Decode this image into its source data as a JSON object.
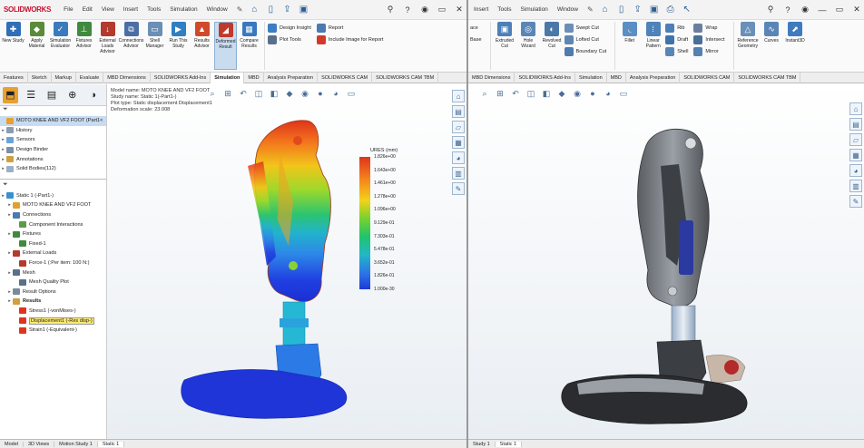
{
  "left": {
    "logo": "SOLIDWORKS",
    "menu": [
      "File",
      "Edit",
      "View",
      "Insert",
      "Tools",
      "Simulation",
      "Window"
    ],
    "ribbon": [
      {
        "label": "New Study",
        "icon": "new-study-icon",
        "color": "#2e6fb5",
        "glyph": "✚"
      },
      {
        "label": "Apply Material",
        "icon": "material-icon",
        "color": "#5b8a3a",
        "glyph": "◆"
      },
      {
        "label": "Simulation Evaluator",
        "icon": "evaluator-icon",
        "color": "#3b7bbd",
        "glyph": "✓"
      },
      {
        "label": "Fixtures Advisor",
        "icon": "fixture-icon",
        "color": "#3f8a3f",
        "glyph": "⊥"
      },
      {
        "label": "External Loads Advisor",
        "icon": "load-icon",
        "color": "#b33a2e",
        "glyph": "↓"
      },
      {
        "label": "Connections Advisor",
        "icon": "connection-icon",
        "color": "#4b6fa5",
        "glyph": "⧉"
      },
      {
        "label": "Shell Manager",
        "icon": "shell-icon",
        "color": "#6b8fb5",
        "glyph": "▭"
      },
      {
        "label": "Run This Study",
        "icon": "run-icon",
        "color": "#2f7fc1",
        "glyph": "▶"
      },
      {
        "label": "Results Advisor",
        "icon": "results-icon",
        "color": "#d04a2a",
        "glyph": "▲"
      },
      {
        "label": "Deformed Result",
        "icon": "deformed-icon",
        "color": "#c0392b",
        "glyph": "◢"
      },
      {
        "label": "Compare Results",
        "icon": "compare-icon",
        "color": "#3878c0",
        "glyph": "▦"
      }
    ],
    "ribbon_small": [
      "Design Insight",
      "Plot Tools"
    ],
    "ribbon_small2": [
      "Report",
      "Include Image for Report"
    ],
    "tabs": [
      "Features",
      "Sketch",
      "Markup",
      "Evaluate",
      "MBD Dimensions",
      "SOLIDWORKS Add-Ins",
      "Simulation",
      "MBD",
      "Analysis Preparation",
      "SOLIDWORKS CAM",
      "SOLIDWORKS CAM TBM"
    ],
    "active_tab": "Simulation",
    "tree_top": [
      {
        "label": "MOTO KNEE AND VF2 FOOT  (Part1<",
        "sel": true
      },
      {
        "label": "History"
      },
      {
        "label": "Sensors"
      },
      {
        "label": "Design Binder"
      },
      {
        "label": "Annotations"
      },
      {
        "label": "Solid Bodies(112)"
      }
    ],
    "tree_sim": [
      {
        "label": "Static 1 (-Part1-)",
        "indent": 0
      },
      {
        "label": "MOTO KNEE AND VF2 FOOT",
        "indent": 1
      },
      {
        "label": "Connections",
        "indent": 1
      },
      {
        "label": "Component Interactions",
        "indent": 2
      },
      {
        "label": "Fixtures",
        "indent": 1
      },
      {
        "label": "Fixed-1",
        "indent": 2
      },
      {
        "label": "External Loads",
        "indent": 1
      },
      {
        "label": "Force-1 (:Per item: 100 N:)",
        "indent": 2
      },
      {
        "label": "Mesh",
        "indent": 1
      },
      {
        "label": "Mesh Quality Plot",
        "indent": 2
      },
      {
        "label": "Result Options",
        "indent": 1
      },
      {
        "label": "Results",
        "indent": 1,
        "bold": true
      },
      {
        "label": "Stress1 (-vonMises-)",
        "indent": 2
      },
      {
        "label": "Displacement1 (-Res disp-)",
        "indent": 2,
        "highlight": true
      },
      {
        "label": "Strain1 (-Equivalent-)",
        "indent": 2
      }
    ],
    "plot_info": [
      "Model name: MOTO KNEE AND VF2 FOOT",
      "Study name: Static 1(-Part1-)",
      "Plot type: Static displacement Displacement1",
      "Deformation scale: 23.008"
    ],
    "legend_title": "URES (mm)",
    "legend_ticks": [
      "1.826e+00",
      "1.643e+00",
      "1.461e+00",
      "1.278e+00",
      "1.096e+00",
      "9.129e-01",
      "7.303e-01",
      "5.478e-01",
      "3.652e-01",
      "1.826e-01",
      "1.000e-30"
    ],
    "bottom_tabs": [
      "Model",
      "3D Views",
      "Motion Study 1",
      "Static 1"
    ],
    "active_bottom": "Static 1"
  },
  "right": {
    "menu": [
      "Insert",
      "Tools",
      "Simulation",
      "Window"
    ],
    "ribbon": [
      {
        "label": "Extruded Cut",
        "icon": "extruded-cut-icon",
        "color": "#4d7fb8",
        "glyph": "▣"
      },
      {
        "label": "Hole Wizard",
        "icon": "hole-wizard-icon",
        "color": "#5a86b6",
        "glyph": "◎"
      },
      {
        "label": "Revolved Cut",
        "icon": "revolved-cut-icon",
        "color": "#4a79a8",
        "glyph": "◐"
      },
      {
        "label": "Fillet",
        "icon": "fillet-icon",
        "color": "#5b8fc4",
        "glyph": "◟"
      },
      {
        "label": "Linear Pattern",
        "icon": "linear-pattern-icon",
        "color": "#4f82b8",
        "glyph": "⁞"
      },
      {
        "label": "Reference Geometry",
        "icon": "ref-geometry-icon",
        "color": "#6a8fb8",
        "glyph": "△"
      },
      {
        "label": "Curves",
        "icon": "curves-icon",
        "color": "#5a86b6",
        "glyph": "∿"
      },
      {
        "label": "Instant3D",
        "icon": "instant3d-icon",
        "color": "#3f7bbf",
        "glyph": "⬈"
      }
    ],
    "ribbon_small": [
      "Swept Cut",
      "Lofted Cut",
      "Boundary Cut"
    ],
    "ribbon_small2": [
      "Rib",
      "Draft",
      "Shell"
    ],
    "ribbon_small3": [
      "Wrap",
      "Intersect",
      "Mirror"
    ],
    "tabs": [
      "MBD Dimensions",
      "SOLIDWORKS Add-Ins",
      "Simulation",
      "MBD",
      "Analysis Preparation",
      "SOLIDWORKS CAM",
      "SOLIDWORKS CAM TBM"
    ],
    "left_cut": [
      "ace",
      "Base"
    ],
    "bottom_tabs": [
      "Study 1",
      "Static 1"
    ],
    "active_bottom": "Static 1"
  }
}
